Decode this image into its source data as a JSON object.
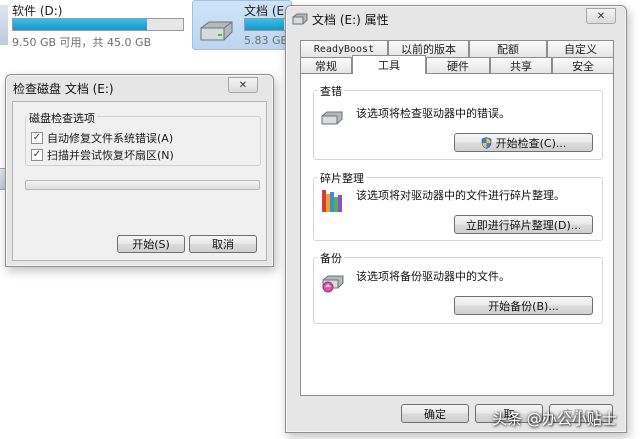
{
  "explorer": {
    "drives": [
      {
        "name": "软件 (D:)",
        "capacity": "9.50 GB 可用，共 45.0 GB",
        "used_fraction": 0.79
      },
      {
        "name": "文档 (E:)",
        "capacity": "5.83 GB",
        "used_fraction": 0.85
      }
    ]
  },
  "properties_dialog": {
    "title": "文档 (E:) 属性",
    "tabs_row1": [
      "ReadyBoost",
      "以前的版本",
      "配额",
      "自定义"
    ],
    "tabs_row2": [
      "常规",
      "工具",
      "硬件",
      "共享",
      "安全"
    ],
    "selected_tab": "工具",
    "sections": {
      "error_check": {
        "title": "查错",
        "description": "该选项将检查驱动器中的错误。",
        "button": "开始检查(C)..."
      },
      "defrag": {
        "title": "碎片整理",
        "description": "该选项将对驱动器中的文件进行碎片整理。",
        "button": "立即进行碎片整理(D)..."
      },
      "backup": {
        "title": "备份",
        "description": "该选项将备份驱动器中的文件。",
        "button": "开始备份(B)..."
      }
    },
    "buttons": {
      "ok": "确定",
      "cancel": "取",
      "apply": "应用(A)"
    }
  },
  "check_dialog": {
    "title": "检查磁盘 文档 (E:)",
    "group_title": "磁盘检查选项",
    "options": [
      {
        "label": "自动修复文件系统错误(A)",
        "checked": true
      },
      {
        "label": "扫描并尝试恢复坏扇区(N)",
        "checked": true
      }
    ],
    "progress": 0,
    "buttons": {
      "start": "开始(S)",
      "cancel": "取消"
    }
  },
  "watermark": "头条 @办公小贴士",
  "close_glyph": "✕",
  "check_glyph": "✓"
}
